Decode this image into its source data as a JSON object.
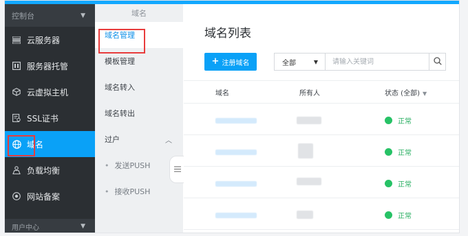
{
  "sidebar": {
    "header": "控制台",
    "items": [
      {
        "label": "云服务器",
        "icon": "list-icon"
      },
      {
        "label": "服务器托管",
        "icon": "server-icon"
      },
      {
        "label": "云虚拟主机",
        "icon": "cube-icon"
      },
      {
        "label": "SSL证书",
        "icon": "certificate-icon"
      },
      {
        "label": "域名",
        "icon": "globe-icon",
        "active": true
      },
      {
        "label": "负载均衡",
        "icon": "balance-icon"
      },
      {
        "label": "网站备案",
        "icon": "record-icon"
      }
    ],
    "footer": "用户中心"
  },
  "subnav": {
    "title": "域名",
    "items": [
      "域名管理",
      "模板管理",
      "域名转入",
      "域名转出",
      "过户"
    ],
    "children": [
      "发送PUSH",
      "接收PUSH"
    ]
  },
  "main": {
    "title": "域名列表",
    "register_button": "注册域名",
    "filter_select": "全部",
    "search_placeholder": "请输入关键词",
    "columns": [
      "域名",
      "所有人",
      "状态 (全部)"
    ],
    "rows": [
      {
        "status": "正常"
      },
      {
        "status": "正常"
      },
      {
        "status": "正常"
      },
      {
        "status": "正常"
      }
    ]
  },
  "colors": {
    "accent": "#0aa1f7",
    "sidebar_bg": "#2b2f33",
    "status_ok": "#27c266",
    "highlight": "#e83b3b"
  }
}
